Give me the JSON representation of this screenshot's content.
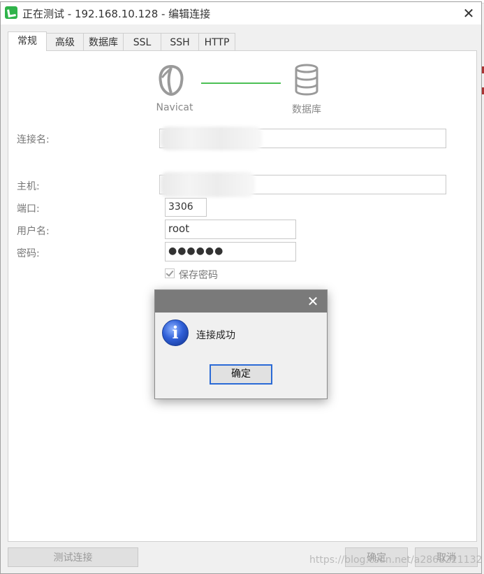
{
  "window": {
    "title": "正在测试 - 192.168.10.128 - 编辑连接"
  },
  "tabs": [
    {
      "label": "常规",
      "active": true
    },
    {
      "label": "高级",
      "active": false
    },
    {
      "label": "数据库",
      "active": false
    },
    {
      "label": "SSL",
      "active": false
    },
    {
      "label": "SSH",
      "active": false
    },
    {
      "label": "HTTP",
      "active": false
    }
  ],
  "flow": {
    "source_label": "Navicat",
    "target_label": "数据库",
    "line_color": "#4cc055"
  },
  "form": {
    "connection_name_label": "连接名:",
    "connection_name_value": "",
    "host_label": "主机:",
    "host_value": "",
    "port_label": "端口:",
    "port_value": "3306",
    "username_label": "用户名:",
    "username_value": "root",
    "password_label": "密码:",
    "password_value": "●●●●●●",
    "save_password_label": "保存密码",
    "save_password_checked": true
  },
  "buttons": {
    "test_connection": "测试连接",
    "ok": "确定",
    "cancel": "取消"
  },
  "dialog": {
    "message": "连接成功",
    "ok_label": "确定",
    "icon": "info-icon",
    "accent_color": "#2a6ad6"
  },
  "watermark": "https://blog.csdn.net/a2868221132"
}
